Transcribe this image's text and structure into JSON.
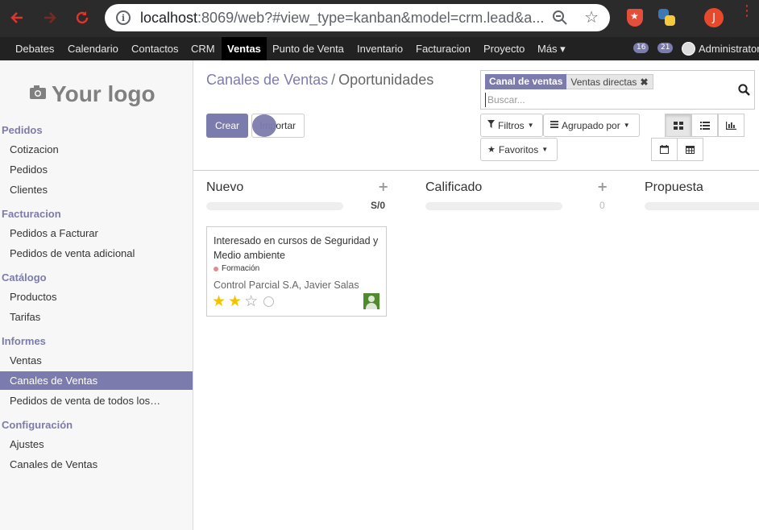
{
  "browser": {
    "url_host": "localhost",
    "url_rest": ":8069/web?#view_type=kanban&model=crm.lead&a...",
    "profile_initial": "J"
  },
  "topnav": {
    "items": [
      "Debates",
      "Calendario",
      "Contactos",
      "CRM",
      "Ventas",
      "Punto de Venta",
      "Inventario",
      "Facturacion",
      "Proyecto",
      "Más"
    ],
    "active": "Ventas",
    "badge_messages": "16",
    "badge_activities": "21",
    "user": "Administrator"
  },
  "sidebar": {
    "logo_text": "Your logo",
    "sections": [
      {
        "title": "Pedidos",
        "items": [
          "Cotizacion",
          "Pedidos",
          "Clientes"
        ]
      },
      {
        "title": "Facturacion",
        "items": [
          "Pedidos a Facturar",
          "Pedidos de venta adicional"
        ]
      },
      {
        "title": "Catálogo",
        "items": [
          "Productos",
          "Tarifas"
        ]
      },
      {
        "title": "Informes",
        "items": [
          "Ventas",
          "Canales de Ventas",
          "Pedidos de venta de todos los…"
        ]
      },
      {
        "title": "Configuración",
        "items": [
          "Ajustes",
          "Canales de Ventas"
        ]
      }
    ],
    "active_item": "Canales de Ventas"
  },
  "breadcrumb": {
    "parent": "Canales de Ventas",
    "separator": "/",
    "current": "Oportunidades"
  },
  "buttons": {
    "create": "Crear",
    "import": "Importar"
  },
  "search": {
    "facet_name": "Canal de ventas",
    "facet_value": "Ventas directas",
    "placeholder": "Buscar..."
  },
  "filters": {
    "filters_label": "Filtros",
    "groupby_label": "Agrupado por",
    "favorites_label": "Favoritos"
  },
  "kanban": {
    "columns": [
      {
        "title": "Nuevo",
        "summary": "S/0"
      },
      {
        "title": "Calificado",
        "summary": "0"
      },
      {
        "title": "Propuesta",
        "summary": ""
      }
    ],
    "card": {
      "title": "Interesado en cursos de Seguridad y Medio ambiente",
      "tag": "Formación",
      "partner": "Control Parcial S.A, Javier Salas",
      "stars_on": 2,
      "stars_total": 3
    }
  },
  "colors": {
    "accent": "#7c7bad",
    "star": "#f3c300",
    "topbar": "#222222"
  }
}
